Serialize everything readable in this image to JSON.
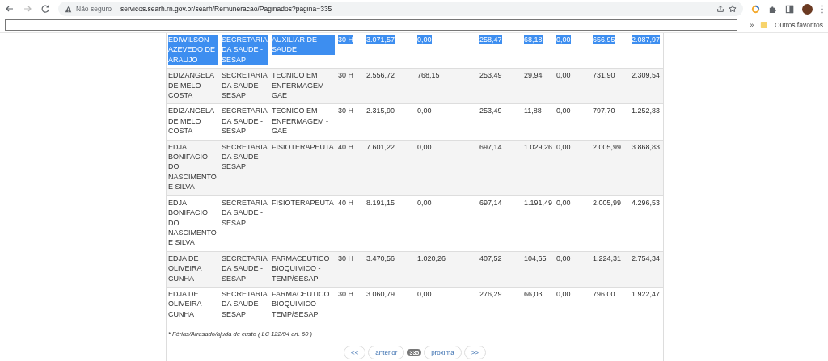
{
  "browser": {
    "security_label": "Não seguro",
    "url": "servicos.searh.rn.gov.br/searh/Remuneracao/Paginados?pagina=335",
    "bookmarks_overflow": "»",
    "bookmark_folder": "Outros favoritos"
  },
  "table": {
    "rows": [
      {
        "selected": true,
        "cells": [
          "EDIWILSON AZEVEDO DE ARAUJO",
          "SECRETARIA DA SAUDE - SESAP",
          "AUXILIAR DE SAUDE",
          "30 H",
          "3.071,57",
          "0,00",
          "258,47",
          "68,18",
          "0,00",
          "656,95",
          "2.087,97"
        ]
      },
      {
        "selected": false,
        "cells": [
          "EDIZANGELA DE MELO COSTA",
          "SECRETARIA DA SAUDE - SESAP",
          "TECNICO EM ENFERMAGEM - GAE",
          "30 H",
          "2.556,72",
          "768,15",
          "253,49",
          "29,94",
          "0,00",
          "731,90",
          "2.309,54"
        ]
      },
      {
        "selected": false,
        "cells": [
          "EDIZANGELA DE MELO COSTA",
          "SECRETARIA DA SAUDE - SESAP",
          "TECNICO EM ENFERMAGEM - GAE",
          "30 H",
          "2.315,90",
          "0,00",
          "253,49",
          "11,88",
          "0,00",
          "797,70",
          "1.252,83"
        ]
      },
      {
        "selected": false,
        "cells": [
          "EDJA BONIFACIO DO NASCIMENTO E SILVA",
          "SECRETARIA DA SAUDE - SESAP",
          "FISIOTERAPEUTA",
          "40 H",
          "7.601,22",
          "0,00",
          "697,14",
          "1.029,26",
          "0,00",
          "2.005,99",
          "3.868,83"
        ]
      },
      {
        "selected": false,
        "cells": [
          "EDJA BONIFACIO DO NASCIMENTO E SILVA",
          "SECRETARIA DA SAUDE - SESAP",
          "FISIOTERAPEUTA",
          "40 H",
          "8.191,15",
          "0,00",
          "697,14",
          "1.191,49",
          "0,00",
          "2.005,99",
          "4.296,53"
        ]
      },
      {
        "selected": false,
        "cells": [
          "EDJA DE OLIVEIRA CUNHA",
          "SECRETARIA DA SAUDE - SESAP",
          "FARMACEUTICO BIOQUIMICO - TEMP/SESAP",
          "30 H",
          "3.470,56",
          "1.020,26",
          "407,52",
          "104,65",
          "0,00",
          "1.224,31",
          "2.754,34"
        ]
      },
      {
        "selected": false,
        "cells": [
          "EDJA DE OLIVEIRA CUNHA",
          "SECRETARIA DA SAUDE - SESAP",
          "FARMACEUTICO BIOQUIMICO - TEMP/SESAP",
          "30 H",
          "3.060,79",
          "0,00",
          "276,29",
          "66,03",
          "0,00",
          "796,00",
          "1.922,47"
        ]
      }
    ]
  },
  "footnote": "* Férias/Atrasado/ajuda de custo ( LC 122/94 art. 60 )",
  "pagination": [
    {
      "kind": "link",
      "label": "<<"
    },
    {
      "kind": "link",
      "label": "anterior"
    },
    {
      "kind": "current",
      "label": "335"
    },
    {
      "kind": "link",
      "label": "próxima"
    },
    {
      "kind": "link",
      "label": ">>"
    }
  ]
}
